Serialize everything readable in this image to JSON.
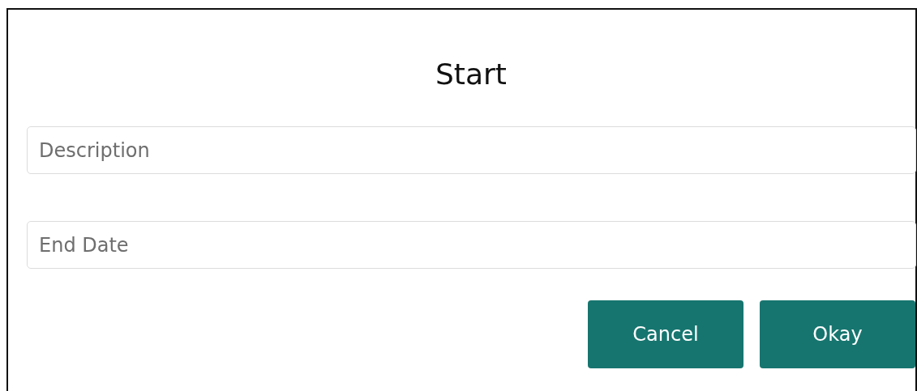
{
  "dialog": {
    "title": "Start",
    "fields": [
      {
        "placeholder": "Description"
      },
      {
        "placeholder": "End Date"
      }
    ],
    "buttons": [
      {
        "label": "Cancel"
      },
      {
        "label": "Okay"
      }
    ]
  }
}
